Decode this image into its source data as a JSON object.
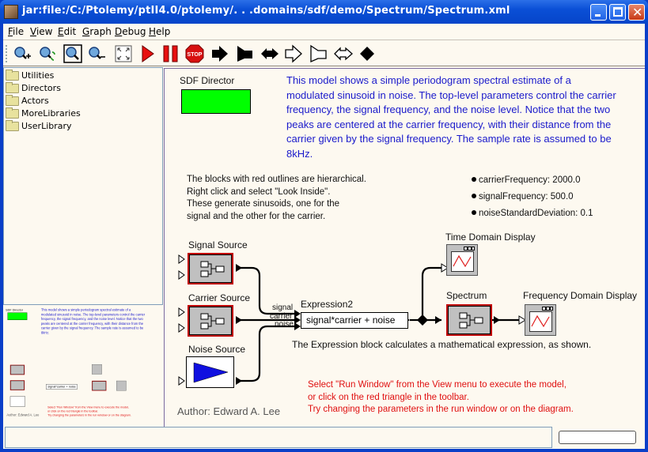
{
  "window": {
    "title": "jar:file:/C:/Ptolemy/ptII4.0/ptolemy/. . .domains/sdf/demo/Spectrum/Spectrum.xml",
    "controls": [
      "minimize",
      "maximize",
      "close"
    ]
  },
  "menubar": {
    "items": [
      "File",
      "View",
      "Edit",
      "Graph",
      "Debug",
      "Help"
    ]
  },
  "toolbar": {
    "buttons": [
      {
        "name": "zoom-in",
        "icon": "zoom-in-icon"
      },
      {
        "name": "zoom-reset",
        "icon": "zoom-reset-icon"
      },
      {
        "name": "zoom-fit",
        "icon": "zoom-fit-icon"
      },
      {
        "name": "zoom-out",
        "icon": "zoom-out-icon"
      },
      {
        "name": "full-screen",
        "icon": "full-screen-icon"
      },
      {
        "name": "run",
        "icon": "run-triangle-icon"
      },
      {
        "name": "pause",
        "icon": "pause-icon"
      },
      {
        "name": "stop",
        "icon": "stop-sign-icon",
        "text": "STOP"
      },
      {
        "name": "input-port",
        "icon": "input-port-icon"
      },
      {
        "name": "output-port",
        "icon": "output-port-icon"
      },
      {
        "name": "input-output-port",
        "icon": "input-output-port-icon"
      },
      {
        "name": "input-multiport",
        "icon": "input-multiport-icon"
      },
      {
        "name": "output-multiport",
        "icon": "output-multiport-icon"
      },
      {
        "name": "input-output-multiport",
        "icon": "input-output-multiport-icon"
      },
      {
        "name": "relation",
        "icon": "relation-diamond-icon"
      }
    ]
  },
  "library": {
    "items": [
      "Utilities",
      "Directors",
      "Actors",
      "MoreLibraries",
      "UserLibrary"
    ]
  },
  "canvas": {
    "director": {
      "label": "SDF Director",
      "color": "#00ff00"
    },
    "description": "This model shows a simple periodogram spectral estimate of a modulated sinusoid in noise. The top-level parameters control the carrier frequency, the signal frequency, and the noise level. Notice that the two peaks are centered at the carrier frequency, with their distance from the carrier given by the signal frequency. The sample rate is assumed to be 8kHz.",
    "hierarchy_note": [
      "The blocks with red outlines are hierarchical.",
      "Right click and select \"Look Inside\".",
      "These generate sinusoids, one for the",
      "signal and the other for the carrier."
    ],
    "parameters": [
      {
        "name": "carrierFrequency",
        "value": "2000.0",
        "text": "carrierFrequency: 2000.0"
      },
      {
        "name": "signalFrequency",
        "value": "500.0",
        "text": "signalFrequency: 500.0"
      },
      {
        "name": "noiseStandardDeviation",
        "value": "0.1",
        "text": "noiseStandardDeviation: 0.1"
      }
    ],
    "blocks": {
      "signal_source": "Signal Source",
      "carrier_source": "Carrier Source",
      "noise_source": "Noise Source",
      "expression_name": "Expression2",
      "expression_value": "signal*carrier + noise",
      "spectrum": "Spectrum",
      "time_display": "Time Domain Display",
      "freq_display": "Frequency Domain Display"
    },
    "ports": {
      "signal": "signal",
      "carrier": "carrier",
      "noise": "noise"
    },
    "expression_note": "The Expression block calculates a mathematical expression, as shown.",
    "run_note": [
      "Select \"Run Window\" from the View menu to execute the model,",
      "or click on the red triangle in the toolbar.",
      "Try changing the parameters in the run window or on the diagram."
    ],
    "author": "Author: Edward A. Lee"
  },
  "colors": {
    "description_text": "#1a1acb",
    "run_note_text": "#e01010",
    "hierarchical_outline": "#c00000",
    "director_fill": "#00ff00"
  },
  "statusbar": {
    "message": "",
    "progress": ""
  }
}
